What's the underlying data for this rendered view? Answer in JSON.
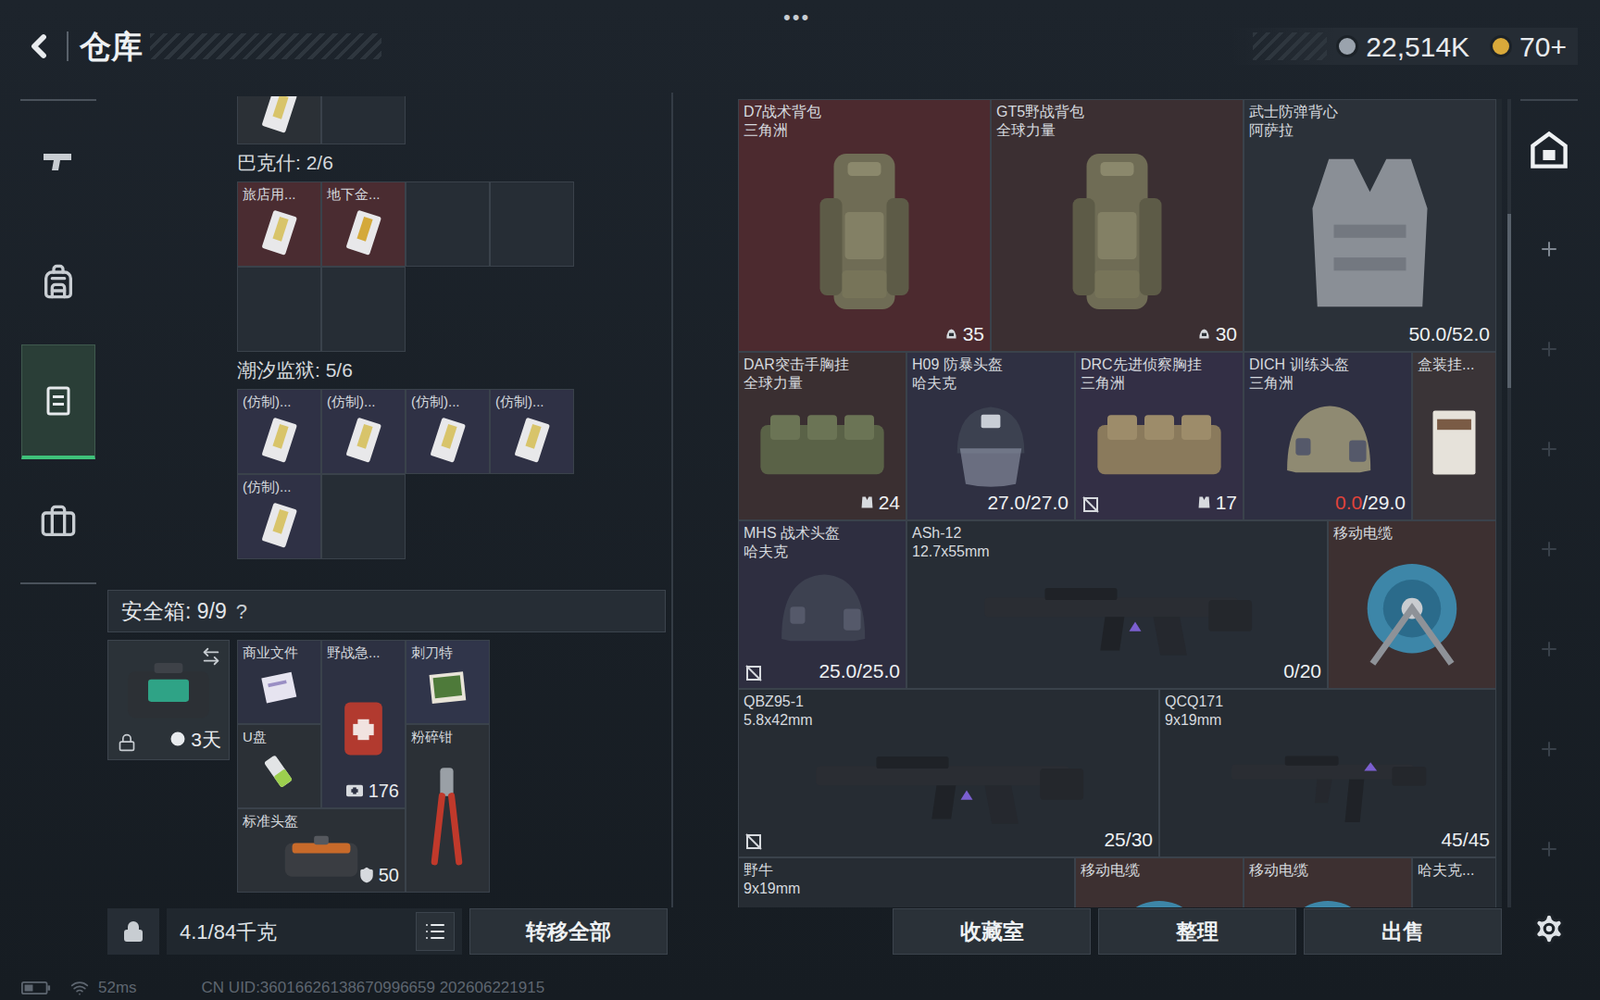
{
  "header": {
    "title": "仓库",
    "menu": "•••",
    "currencies": [
      {
        "value": "22,514K",
        "color": "#9aa3ad"
      },
      {
        "value": "70+",
        "color": "#d9a93a"
      }
    ]
  },
  "sidebar": {
    "items": [
      {
        "selected": false
      },
      {
        "selected": false
      },
      {
        "selected": true
      },
      {
        "selected": false
      }
    ]
  },
  "stash": {
    "top_row": [
      {
        "filled": true,
        "label": "",
        "kind": "card",
        "color": "#2b3036"
      },
      {
        "filled": false
      }
    ],
    "sections": [
      {
        "title": "巴克什: 2/6",
        "slots": [
          {
            "filled": true,
            "label": "旅店用...",
            "kind": "card",
            "color": "#4a2c31"
          },
          {
            "filled": true,
            "label": "地下金...",
            "kind": "goldcard",
            "color": "#4a2c31"
          },
          {
            "filled": false
          },
          {
            "filled": false
          },
          {
            "filled": false
          },
          {
            "filled": false
          }
        ]
      },
      {
        "title": "潮汐监狱: 5/6",
        "slots": [
          {
            "filled": true,
            "label": "(仿制)...",
            "kind": "card",
            "color": "#2f3145"
          },
          {
            "filled": true,
            "label": "(仿制)...",
            "kind": "card",
            "color": "#2f3145"
          },
          {
            "filled": true,
            "label": "(仿制)...",
            "kind": "card",
            "color": "#2f3145"
          },
          {
            "filled": true,
            "label": "(仿制)...",
            "kind": "card",
            "color": "#2f3145"
          },
          {
            "filled": true,
            "label": "(仿制)...",
            "kind": "card",
            "color": "#2f3145"
          },
          {
            "filled": false
          }
        ]
      }
    ]
  },
  "safe_box": {
    "title": "安全箱: 9/9",
    "help": "?",
    "case": {
      "locked": true,
      "time": "3天",
      "swap": true
    },
    "items": [
      {
        "label": "商业文件",
        "kind": "doc",
        "color": "#2d3142"
      },
      {
        "label": "野战急...",
        "kind": "medkit",
        "value": "176",
        "value_icon": "med",
        "color": "#2d3142"
      },
      {
        "label": "刺刀特",
        "kind": "photo",
        "color": "#30354a"
      },
      {
        "label": "U盘",
        "kind": "usb",
        "color": "#2b3036"
      },
      {
        "label": "粉碎钳",
        "kind": "pliers",
        "color": "#2b3036"
      },
      {
        "label": "标准头盔",
        "kind": "bag",
        "value": "50",
        "value_icon": "shield",
        "color": "#2b3036"
      }
    ]
  },
  "weight": "4.1/84千克",
  "transfer_button": "转移全部",
  "items": [
    {
      "name": "D7战术背包",
      "sub": "三角洲",
      "kind": "backpack",
      "color": "#4c2a2f",
      "value": "35",
      "value_icon": "bag",
      "no_trade": false
    },
    {
      "name": "GT5野战背包",
      "sub": "全球力量",
      "kind": "backpack",
      "color": "#3b2f32",
      "value": "30",
      "value_icon": "bag",
      "no_trade": false
    },
    {
      "name": "武士防弹背心",
      "sub": "阿萨拉",
      "kind": "vest",
      "color": "#2b3139",
      "value": "50.0/52.0",
      "value_icon": "none",
      "no_trade": false
    },
    {
      "name": "DAR突击手胸挂",
      "sub": "全球力量",
      "kind": "rig",
      "color": "#3a2f31",
      "value": "24",
      "value_icon": "vest",
      "no_trade": false
    },
    {
      "name": "H09 防暴头盔",
      "sub": "哈夫克",
      "kind": "riot",
      "color": "#2f3042",
      "value": "27.0/27.0",
      "value_icon": "none",
      "no_trade": false
    },
    {
      "name": "DRC先进侦察胸挂",
      "sub": "三角洲",
      "kind": "rig2",
      "color": "#332f45",
      "value": "17",
      "value_icon": "vest",
      "no_trade": true
    },
    {
      "name": "DICH 训练头盔",
      "sub": "三角洲",
      "kind": "helmet",
      "color": "#2e2f42",
      "value_warn": "0.0",
      "value": "/29.0",
      "value_icon": "none",
      "no_trade": false
    },
    {
      "name": "盒装挂...",
      "sub": "",
      "kind": "box",
      "color": "#3a3437",
      "value_icon": "none",
      "no_trade": false
    },
    {
      "name": "MHS 战术头盔",
      "sub": "哈夫克",
      "kind": "helmet2",
      "color": "#2e2e40",
      "value": "25.0/25.0",
      "value_icon": "none",
      "no_trade": true
    },
    {
      "name": "ASh-12",
      "sub": "12.7x55mm",
      "kind": "rifle",
      "color": "#272d35",
      "value": "0/20",
      "value_icon": "none",
      "no_trade": false
    },
    {
      "name": "移动电缆",
      "sub": "",
      "kind": "cable",
      "color": "#3d3031",
      "value_icon": "none",
      "no_trade": false
    },
    {
      "name": "QBZ95-1",
      "sub": "5.8x42mm",
      "kind": "rifle",
      "color": "#262c33",
      "value": "25/30",
      "value_icon": "none",
      "no_trade": true
    },
    {
      "name": "QCQ171",
      "sub": "9x19mm",
      "kind": "smg",
      "color": "#262c33",
      "value": "45/45",
      "value_icon": "none",
      "no_trade": false
    },
    {
      "name": "野牛",
      "sub": "9x19mm",
      "kind": "smg",
      "color": "#262c33",
      "value_icon": "none",
      "no_trade": false
    },
    {
      "name": "移动电缆",
      "sub": "",
      "kind": "cable",
      "color": "#3d3031",
      "value_icon": "none",
      "no_trade": false
    },
    {
      "name": "移动电缆",
      "sub": "",
      "kind": "cable",
      "color": "#3d3031",
      "value_icon": "none",
      "no_trade": false
    },
    {
      "name": "哈夫克...",
      "sub": "",
      "kind": "box",
      "color": "#262c33",
      "value_icon": "none",
      "no_trade": false
    }
  ],
  "buttons": [
    "收藏室",
    "整理",
    "出售"
  ],
  "rail": {
    "slots": [
      {
        "dim": false
      },
      {
        "dim": true
      },
      {
        "dim": true
      },
      {
        "dim": true
      },
      {
        "dim": true
      },
      {
        "dim": true
      },
      {
        "dim": true
      }
    ]
  },
  "status_bar": {
    "ping": "52ms",
    "uid": "CN UID:36016626138670996659 202606221915"
  }
}
